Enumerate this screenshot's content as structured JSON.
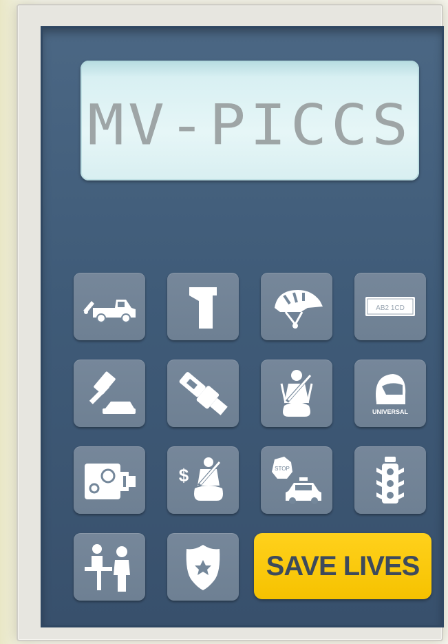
{
  "app": {
    "display_text": "MV-PICCS",
    "action_button_label": "SAVE LIVES",
    "accent_color": "#ffcc00",
    "panel_color": "#3f5b78",
    "key_color": "#74879a"
  },
  "keys": [
    {
      "icon": "tow-truck-icon"
    },
    {
      "icon": "breathalyzer-icon"
    },
    {
      "icon": "bicycle-helmet-icon"
    },
    {
      "icon": "license-plate-icon",
      "label": "AB2 1CD"
    },
    {
      "icon": "gavel-icon"
    },
    {
      "icon": "seat-belt-buckle-icon"
    },
    {
      "icon": "child-seat-belt-icon"
    },
    {
      "icon": "motorcycle-helmet-icon",
      "label": "UNIVERSAL"
    },
    {
      "icon": "speed-camera-icon"
    },
    {
      "icon": "seat-belt-fine-icon"
    },
    {
      "icon": "stop-sign-police-car-icon",
      "label": "STOP"
    },
    {
      "icon": "traffic-light-icon"
    },
    {
      "icon": "officer-at-desk-icon"
    },
    {
      "icon": "police-badge-icon"
    }
  ]
}
